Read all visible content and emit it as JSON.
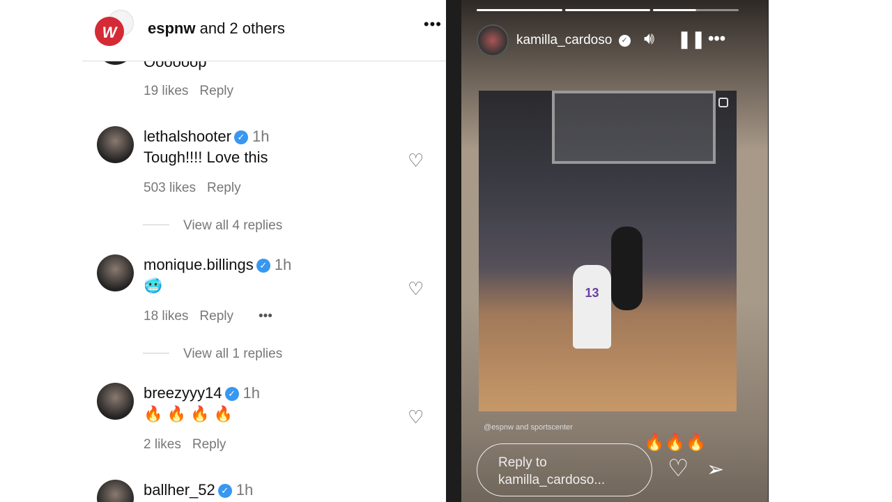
{
  "post_header": {
    "account": "espnw",
    "others": "and 2 others",
    "logo_text": "W",
    "more_icon": "•••"
  },
  "comments": [
    {
      "text": "Oooooop",
      "likes": "19 likes",
      "reply": "Reply"
    },
    {
      "user": "lethalshooter",
      "time": "1h",
      "text": "Tough!!!! Love this",
      "likes": "503 likes",
      "reply": "Reply",
      "view_replies": "View all 4 replies"
    },
    {
      "user": "monique.billings",
      "time": "1h",
      "text": "🥶",
      "likes": "18 likes",
      "reply": "Reply",
      "more": "•••",
      "view_replies": "View all 1 replies"
    },
    {
      "user": "breezyyy14",
      "time": "1h",
      "text": "🔥 🔥 🔥 🔥",
      "likes": "2 likes",
      "reply": "Reply"
    },
    {
      "user": "ballher_52",
      "time": "1h"
    }
  ],
  "story": {
    "user": "kamilla_cardoso",
    "credit": "@espnw and sportscenter",
    "reaction": "🔥🔥🔥",
    "reply_placeholder": "Reply to kamilla_cardoso...",
    "progress": [
      1,
      1,
      0.5
    ],
    "jersey": "13"
  }
}
